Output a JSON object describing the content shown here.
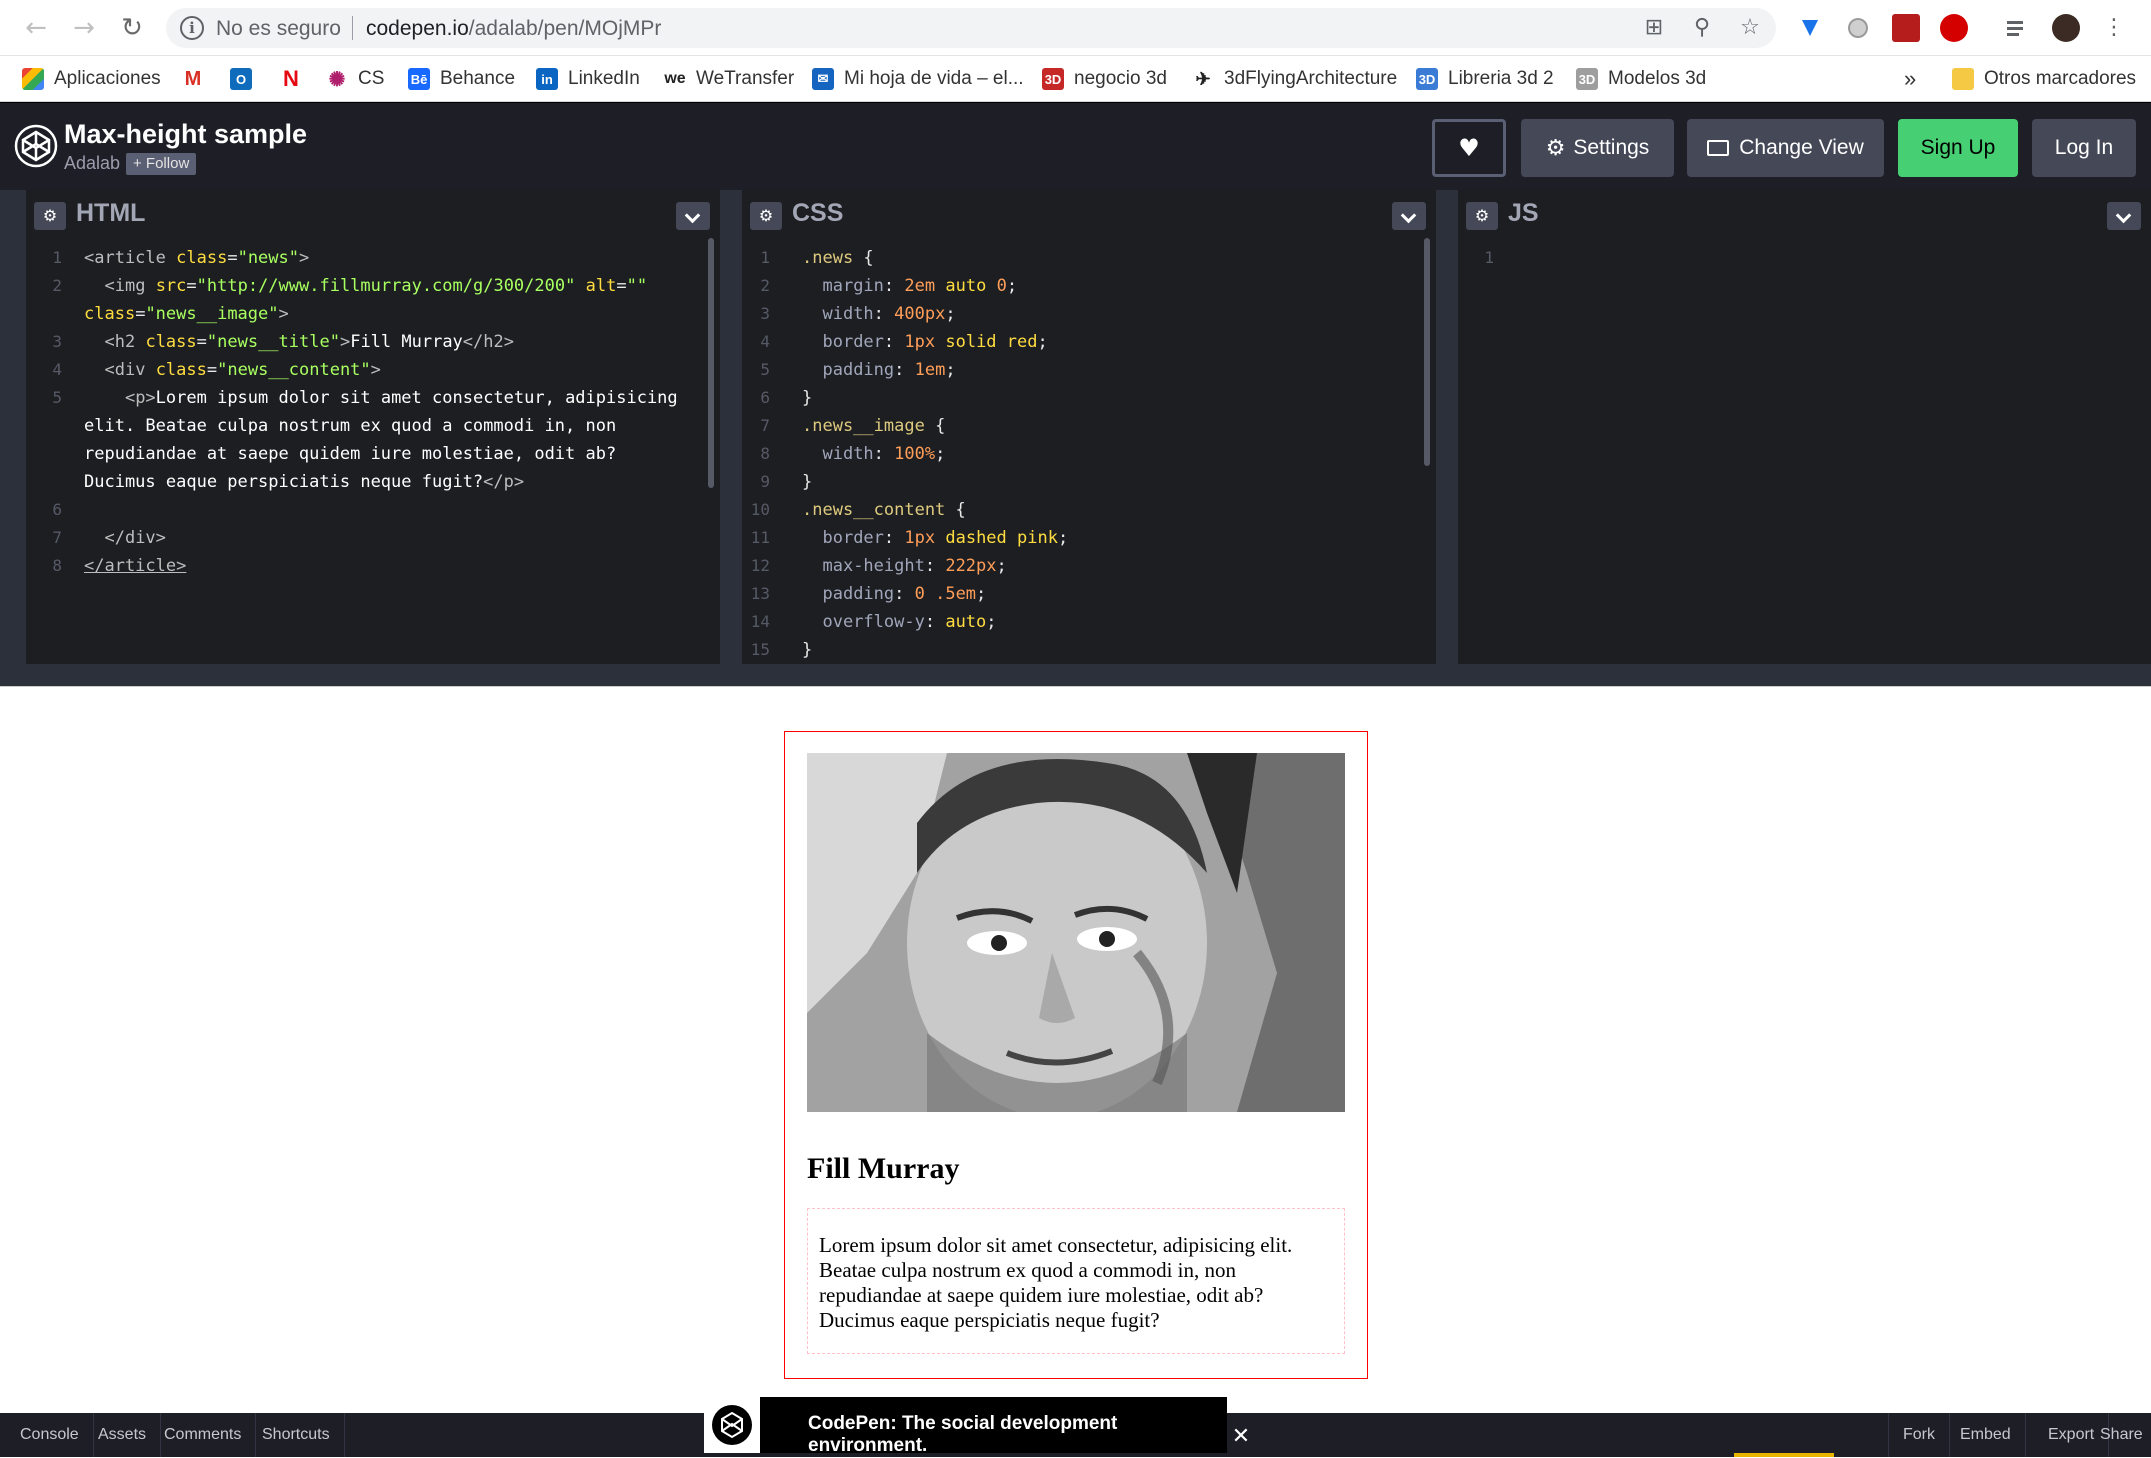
{
  "browser": {
    "insecure_label": "No es seguro",
    "url_host": "codepen.io",
    "url_path": "/adalab/pen/MOjMPr",
    "bookmarks": [
      {
        "label": "Aplicaciones",
        "icon": "apps-grid-icon"
      },
      {
        "label": "",
        "icon": "gmail-icon"
      },
      {
        "label": "",
        "icon": "outlook-icon"
      },
      {
        "label": "",
        "icon": "netflix-icon"
      },
      {
        "label": "CS",
        "icon": "cs-icon"
      },
      {
        "label": "Behance",
        "icon": "behance-icon"
      },
      {
        "label": "LinkedIn",
        "icon": "linkedin-icon"
      },
      {
        "label": "WeTransfer",
        "icon": "wetransfer-icon"
      },
      {
        "label": "Mi hoja de vida – el...",
        "icon": "resume-icon"
      },
      {
        "label": "negocio 3d",
        "icon": "3d-icon"
      },
      {
        "label": "3dFlyingArchitecture",
        "icon": "flying-icon"
      },
      {
        "label": "Libreria 3d 2",
        "icon": "3d-blue-icon"
      },
      {
        "label": "Modelos 3d",
        "icon": "3d-grey-icon"
      }
    ],
    "more_label": "»",
    "other_bookmarks": "Otros marcadores"
  },
  "header": {
    "title": "Max-height sample",
    "author": "Adalab",
    "follow": "+ Follow",
    "settings": "Settings",
    "change_view": "Change View",
    "sign_up": "Sign Up",
    "log_in": "Log In",
    "colors": {
      "sign_up": "#47cf73",
      "button": "#444857",
      "bg": "#1e1f26"
    }
  },
  "editors": {
    "html_title": "HTML",
    "css_title": "CSS",
    "js_title": "JS"
  },
  "preview": {
    "title": "Fill Murray",
    "content": "Lorem ipsum dolor sit amet consectetur, adipisicing elit. Beatae culpa nostrum ex quod a commodi in, non repudiandae at saepe quidem iure molestiae, odit ab? Ducimus eaque perspiciatis neque fugit?"
  },
  "footer": {
    "console": "Console",
    "assets": "Assets",
    "comments": "Comments",
    "shortcuts": "Shortcuts",
    "fork": "Fork",
    "embed": "Embed",
    "export": "Export",
    "share": "Share",
    "toast": "CodePen: The social development environment.",
    "close": "✕"
  }
}
